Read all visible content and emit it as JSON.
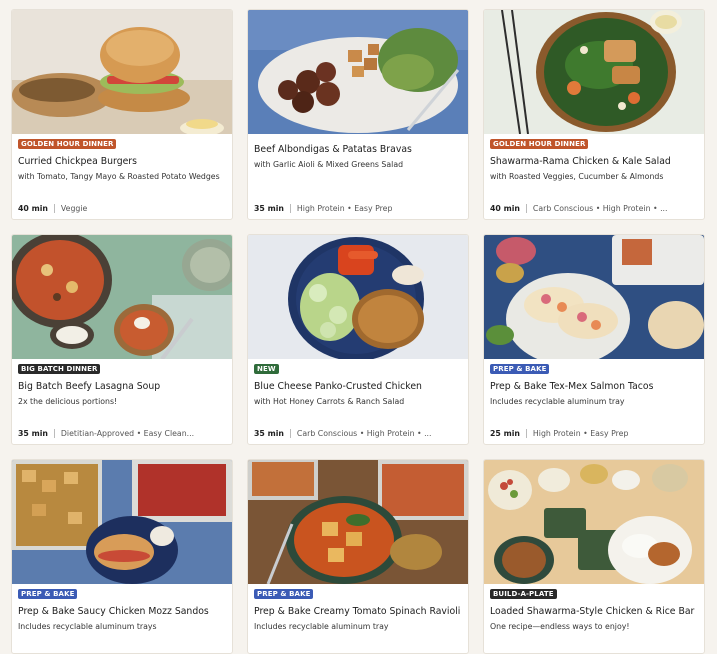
{
  "badge_colors": {
    "golden": "#c0552b",
    "bigbatch": "#2a2a2a",
    "new": "#2f6b3a",
    "prep": "#3b5bb5",
    "build": "#2a2a2a"
  },
  "cards": [
    {
      "badge": "GOLDEN HOUR DINNER",
      "badge_type": "golden",
      "title": "Curried Chickpea Burgers",
      "subtitle": "with Tomato, Tangy Mayo & Roasted Potato Wedges",
      "time": "40 min",
      "tags": "Veggie",
      "image": "chickpea-burger-photo"
    },
    {
      "badge": "",
      "badge_type": "",
      "title": "Beef Albondigas & Patatas Bravas",
      "subtitle": "with Garlic Aioli & Mixed Greens Salad",
      "time": "35 min",
      "tags": "High Protein • Easy Prep",
      "image": "albondigas-photo"
    },
    {
      "badge": "GOLDEN HOUR DINNER",
      "badge_type": "golden",
      "title": "Shawarma-Rama Chicken & Kale Salad",
      "subtitle": "with Roasted Veggies, Cucumber & Almonds",
      "time": "40 min",
      "tags": "Carb Conscious • High Protein • ...",
      "image": "kale-salad-photo"
    },
    {
      "badge": "BIG BATCH DINNER",
      "badge_type": "bigbatch",
      "title": "Big Batch Beefy Lasagna Soup",
      "subtitle": "2x the delicious portions!",
      "time": "35 min",
      "tags": "Dietitian-Approved • Easy Clean...",
      "image": "lasagna-soup-photo"
    },
    {
      "badge": "NEW",
      "badge_type": "new",
      "title": "Blue Cheese Panko-Crusted Chicken",
      "subtitle": "with Hot Honey Carrots & Ranch Salad",
      "time": "35 min",
      "tags": "Carb Conscious • High Protein • ...",
      "image": "panko-chicken-photo"
    },
    {
      "badge": "PREP & BAKE",
      "badge_type": "prep",
      "title": "Prep & Bake Tex-Mex Salmon Tacos",
      "subtitle": "Includes recyclable aluminum tray",
      "time": "25 min",
      "tags": "High Protein • Easy Prep",
      "image": "salmon-tacos-photo"
    },
    {
      "badge": "PREP & BAKE",
      "badge_type": "prep",
      "title": "Prep & Bake Saucy Chicken Mozz Sandos",
      "subtitle": "Includes recyclable aluminum trays",
      "time": "",
      "tags": "",
      "image": "mozz-sandos-photo"
    },
    {
      "badge": "PREP & BAKE",
      "badge_type": "prep",
      "title": "Prep & Bake Creamy Tomato Spinach Ravioli",
      "subtitle": "Includes recyclable aluminum tray",
      "time": "",
      "tags": "",
      "image": "ravioli-photo"
    },
    {
      "badge": "BUILD-A-PLATE",
      "badge_type": "build",
      "title": "Loaded Shawarma-Style Chicken & Rice Bar",
      "subtitle": "One recipe—endless ways to enjoy!",
      "time": "",
      "tags": "",
      "image": "rice-bar-photo"
    }
  ]
}
